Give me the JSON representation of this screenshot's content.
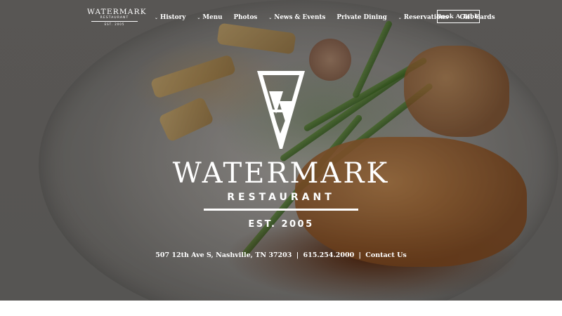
{
  "header": {
    "logo": {
      "title": "WATERMARK",
      "subtitle": "RESTAURANT",
      "est": "EST. 2005"
    },
    "nav": [
      {
        "label": "History",
        "has_dropdown": true
      },
      {
        "label": "Menu",
        "has_dropdown": true
      },
      {
        "label": "Photos",
        "has_dropdown": false
      },
      {
        "label": "News & Events",
        "has_dropdown": true
      },
      {
        "label": "Private Dining",
        "has_dropdown": false
      },
      {
        "label": "Reservations",
        "has_dropdown": true
      },
      {
        "label": "Gift Cards",
        "has_dropdown": false
      }
    ],
    "book_button": "Book A Table"
  },
  "hero": {
    "brand_name": "WATERMARK",
    "brand_subtitle": "RESTAURANT",
    "established": "EST. 2005",
    "contact": {
      "address": "507 12th Ave S, Nashville, TN 37203",
      "separator": "|",
      "phone": "615.254.2000",
      "contact_link": "Contact Us"
    }
  },
  "icons": {
    "dropdown": "chevron-down-icon",
    "brand_mark": "watermark-logo-icon"
  },
  "colors": {
    "text": "#ffffff",
    "page_background": "#ffffff"
  }
}
